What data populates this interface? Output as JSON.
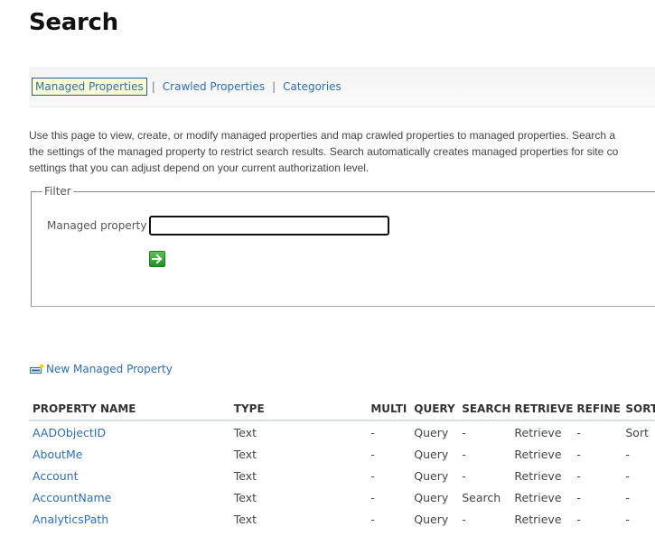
{
  "page": {
    "title": "Search"
  },
  "nav": {
    "items": [
      {
        "label": "Managed Properties",
        "active": true
      },
      {
        "label": "Crawled Properties",
        "active": false
      },
      {
        "label": "Categories",
        "active": false
      }
    ],
    "separator": "|"
  },
  "description": {
    "lines": [
      "Use this page to view, create, or modify managed properties and map crawled properties to managed properties. Search a",
      "the settings of the managed property to restrict search results. Search automatically creates managed properties for site co",
      "settings that you can adjust depend on your current authorization level."
    ]
  },
  "filter": {
    "legend": "Filter",
    "label": "Managed property",
    "value": "",
    "go_icon": "arrow-right-icon"
  },
  "new_property": {
    "label": "New Managed Property",
    "icon": "new-item-icon"
  },
  "table": {
    "headers": [
      "PROPERTY NAME",
      "TYPE",
      "MULTI",
      "QUERY",
      "SEARCH",
      "RETRIEVE",
      "REFINE",
      "SORT"
    ],
    "rows": [
      {
        "name": "AADObjectID",
        "type": "Text",
        "multi": "-",
        "query": "Query",
        "search": "-",
        "retrieve": "Retrieve",
        "refine": "-",
        "sort": "Sort"
      },
      {
        "name": "AboutMe",
        "type": "Text",
        "multi": "-",
        "query": "Query",
        "search": "-",
        "retrieve": "Retrieve",
        "refine": "-",
        "sort": "-"
      },
      {
        "name": "Account",
        "type": "Text",
        "multi": "-",
        "query": "Query",
        "search": "-",
        "retrieve": "Retrieve",
        "refine": "-",
        "sort": "-"
      },
      {
        "name": "AccountName",
        "type": "Text",
        "multi": "-",
        "query": "Query",
        "search": "Search",
        "retrieve": "Retrieve",
        "refine": "-",
        "sort": "-"
      },
      {
        "name": "AnalyticsPath",
        "type": "Text",
        "multi": "-",
        "query": "Query",
        "search": "-",
        "retrieve": "Retrieve",
        "refine": "-",
        "sort": "-"
      }
    ]
  },
  "colors": {
    "link": "#2d6fb7",
    "active_tab_bg": "#fdfbd0",
    "active_tab_border": "#2a5a9e",
    "go_button": "#229022"
  }
}
